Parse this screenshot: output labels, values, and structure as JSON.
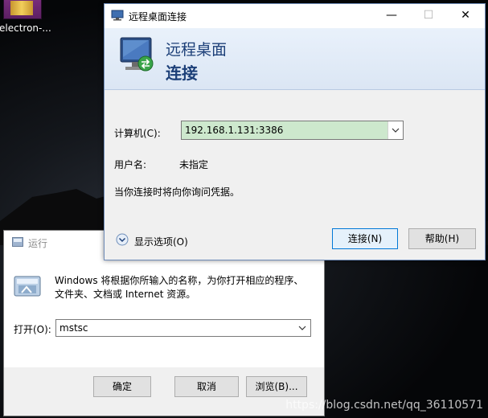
{
  "desktop": {
    "icon_label": "electron-..."
  },
  "run_dialog": {
    "title": "运行",
    "description": "Windows 将根据你所输入的名称，为你打开相应的程序、文件夹、文档或 Internet 资源。",
    "open_label": "打开(O):",
    "open_value": "mstsc",
    "ok_label": "确定",
    "cancel_label": "取消",
    "browse_label": "浏览(B)..."
  },
  "rdp_dialog": {
    "title": "远程桌面连接",
    "banner_line1": "远程桌面",
    "banner_line2": "连接",
    "computer_label": "计算机(C):",
    "computer_value": "192.168.1.131:3386",
    "username_label": "用户名:",
    "username_value": "未指定",
    "note": "当你连接时将向你询问凭据。",
    "show_options_label": "显示选项(O)",
    "connect_label": "连接(N)",
    "help_label": "帮助(H)",
    "minimize_glyph": "—",
    "maximize_glyph": "☐",
    "close_glyph": "✕"
  },
  "watermark": "https://blog.csdn.net/qq_36110571",
  "colors": {
    "combo_highlight": "#cde8cd",
    "banner_text": "#1c3f78",
    "primary_button_border": "#0078d7"
  }
}
